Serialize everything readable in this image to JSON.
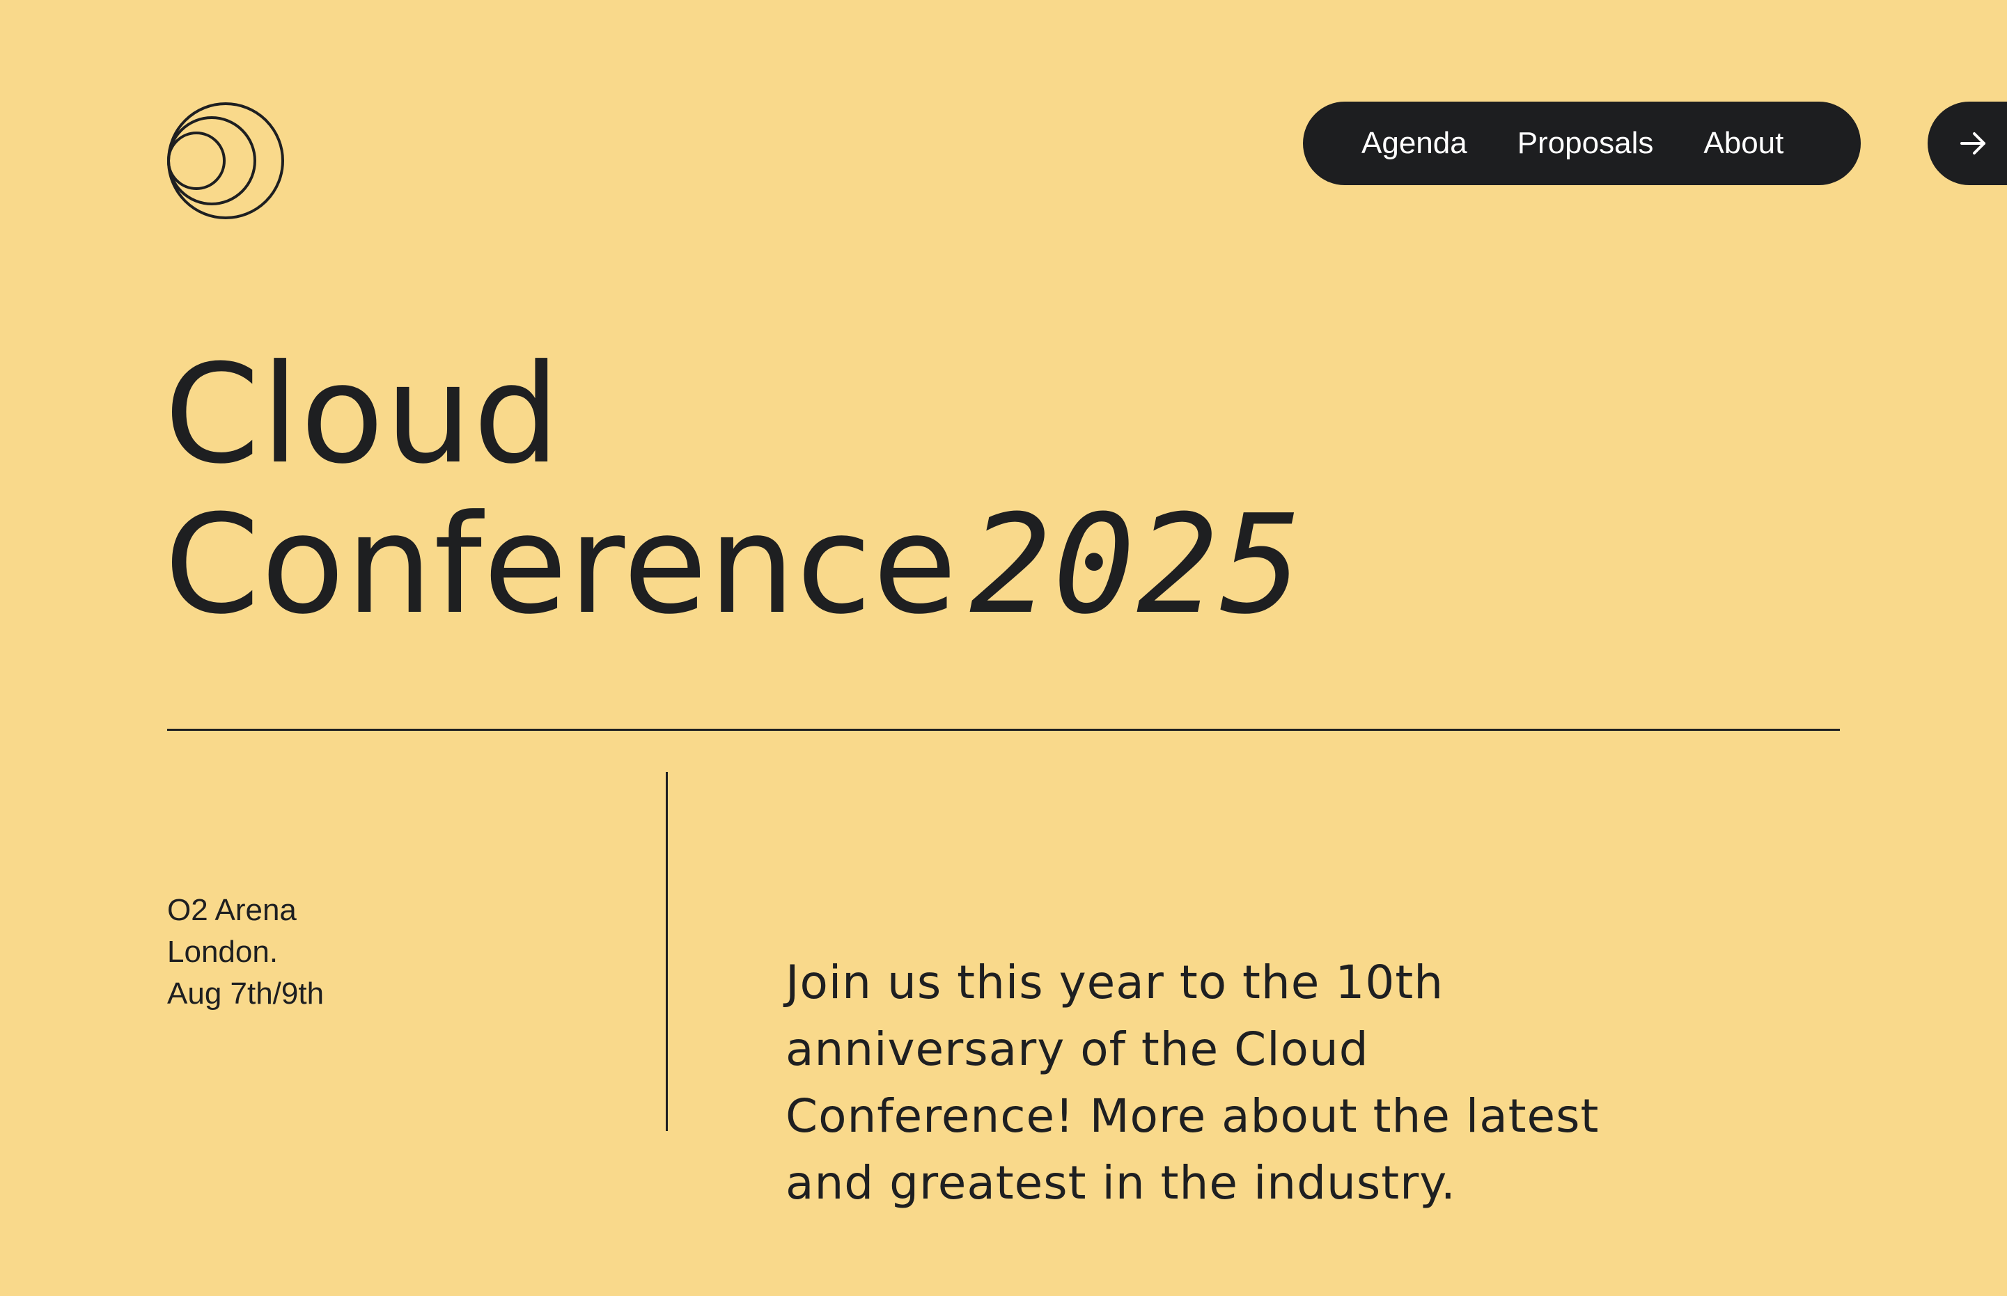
{
  "nav": {
    "items": [
      {
        "label": "Agenda"
      },
      {
        "label": "Proposals"
      },
      {
        "label": "About"
      }
    ],
    "cta_icon": "arrow-right-icon"
  },
  "logo_icon": "concentric-circles-logo",
  "hero": {
    "title_line1": "Cloud",
    "title_line2": "Conference",
    "title_year": "2025"
  },
  "venue": {
    "line1": "O2 Arena",
    "line2": "London.",
    "line3": "Aug 7th/9th"
  },
  "description": "Join us this year to the 10th anniversary of the Cloud Conference! More about the latest and greatest in the industry.",
  "colors": {
    "background": "#f9d98b",
    "ink": "#1e1f21",
    "nav_bg": "#1d1e20",
    "nav_text": "#ffffff"
  }
}
